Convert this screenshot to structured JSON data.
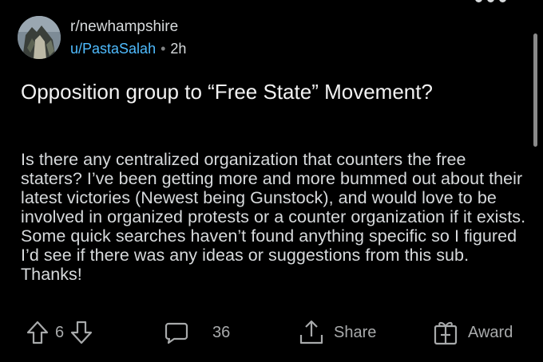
{
  "post": {
    "subreddit": "r/newhampshire",
    "author": "u/PastaSalah",
    "separator": "•",
    "age": "2h",
    "title": "Opposition group to “Free State” Movement?",
    "body": "Is there any centralized organization that counters the free staters? I’ve been getting more and more bummed out about their latest victories (Newest being Gunstock), and would love to be involved in organized protests or a counter organization if it exists. Some quick searches haven’t found anything specific so I figured I’d see if there was any ideas or suggestions from this sub. Thanks!"
  },
  "actions": {
    "vote_count": "6",
    "comment_count": "36",
    "share_label": "Share",
    "award_label": "Award"
  },
  "icons": {
    "upvote": "upvote-icon",
    "downvote": "downvote-icon",
    "comment": "comment-icon",
    "share": "share-icon",
    "award": "award-icon",
    "more": "more-dots-icon"
  },
  "colors": {
    "background": "#000000",
    "author_link": "#4fbcff",
    "text": "#d7dadc",
    "icon": "#a8aaab"
  }
}
